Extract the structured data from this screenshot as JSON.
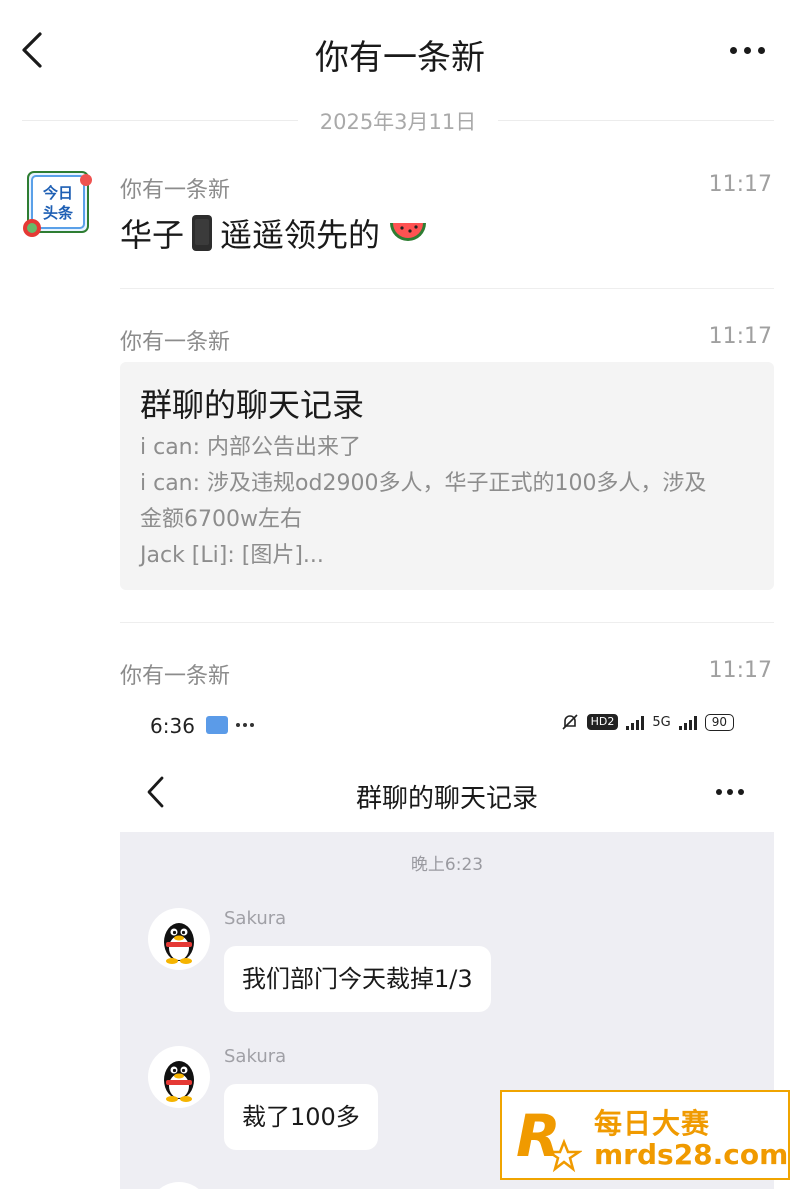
{
  "header": {
    "title": "你有一条新",
    "back_icon": "chevron-left-icon",
    "more_icon": "more-dots-icon"
  },
  "date_divider": "2025年3月11日",
  "messages": [
    {
      "sender": "你有一条新",
      "time": "11:17",
      "text_before": "华子",
      "emoji1": "mobile-phone-icon",
      "text_after": "遥遥领先的",
      "emoji2": "watermelon-icon",
      "avatar": "今日头条"
    },
    {
      "sender": "你有一条新",
      "time": "11:17",
      "card": {
        "title": "群聊的聊天记录",
        "lines": [
          "i can: 内部公告出来了",
          "i can: 涉及违规od2900多人，华子正式的100多人，涉及",
          "金额6700w左右",
          "Jack [Li]: [图片]..."
        ]
      }
    },
    {
      "sender": "你有一条新",
      "time": "11:17",
      "screenshot": {
        "status_time": "6:36",
        "status_badge": "HD2",
        "status_net": "5G",
        "battery": "90",
        "title": "群聊的聊天记录",
        "chat_time": "晚上6:23",
        "chats": [
          {
            "name": "Sakura",
            "text": "我们部门今天裁掉1/3"
          },
          {
            "name": "Sakura",
            "text": "裁了100多"
          }
        ]
      }
    }
  ],
  "watermark": {
    "line1": "每日大赛",
    "line2": "mrds28.com",
    "brand_color": "#f09a00"
  }
}
